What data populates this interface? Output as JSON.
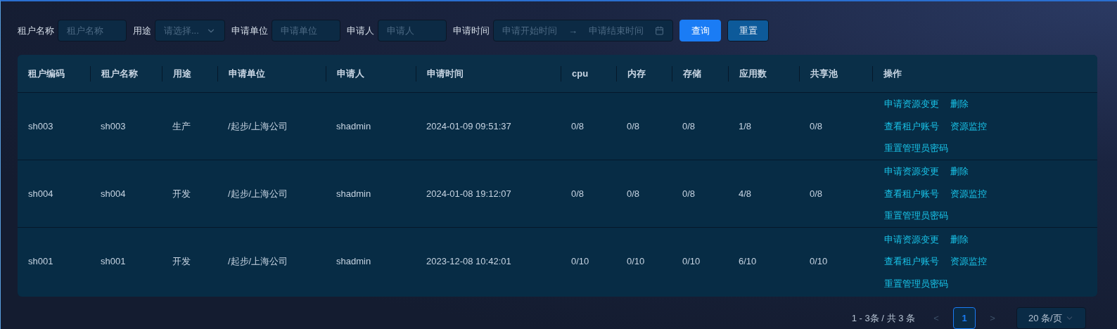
{
  "filters": [
    {
      "label": "租户名称",
      "kind": "input",
      "placeholder": "租户名称"
    },
    {
      "label": "用途",
      "kind": "select",
      "placeholder": "请选择..."
    },
    {
      "label": "申请单位",
      "kind": "input",
      "placeholder": "申请单位"
    },
    {
      "label": "申请人",
      "kind": "input",
      "placeholder": "申请人"
    },
    {
      "label": "申请时间",
      "kind": "range",
      "placeholder": "申请开始时间",
      "placeholder_end": "申请结束时间",
      "separator": "→"
    }
  ],
  "buttons": [
    {
      "label": "查询",
      "kind": "primary"
    },
    {
      "label": "重置",
      "kind": "secondary"
    }
  ],
  "table": {
    "columns": [
      "租户编码",
      "租户名称",
      "用途",
      "申请单位",
      "申请人",
      "申请时间",
      "cpu",
      "内存",
      "存储",
      "应用数",
      "共享池",
      "操作"
    ],
    "rows": [
      {
        "cells": [
          "sh003",
          "sh003",
          "生产",
          "/起步/上海公司",
          "shadmin",
          "2024-01-09 09:51:37",
          "0/8",
          "0/8",
          "0/8",
          "1/8",
          "0/8"
        ],
        "actions": [
          "申请资源变更",
          "删除",
          "查看租户账号",
          "资源监控",
          "重置管理员密码"
        ]
      },
      {
        "cells": [
          "sh004",
          "sh004",
          "开发",
          "/起步/上海公司",
          "shadmin",
          "2024-01-08 19:12:07",
          "0/8",
          "0/8",
          "0/8",
          "4/8",
          "0/8"
        ],
        "actions": [
          "申请资源变更",
          "删除",
          "查看租户账号",
          "资源监控",
          "重置管理员密码"
        ]
      },
      {
        "cells": [
          "sh001",
          "sh001",
          "开发",
          "/起步/上海公司",
          "shadmin",
          "2023-12-08 10:42:01",
          "0/10",
          "0/10",
          "0/10",
          "6/10",
          "0/10"
        ],
        "actions": [
          "申请资源变更",
          "删除",
          "查看租户账号",
          "资源监控",
          "重置管理员密码"
        ]
      }
    ]
  },
  "pagination": {
    "summary": "1 - 3条 / 共 3 条",
    "prev": "<",
    "next": ">",
    "pages": [
      {
        "label": "1",
        "selected": true
      }
    ],
    "page_size": "20 条/页"
  }
}
